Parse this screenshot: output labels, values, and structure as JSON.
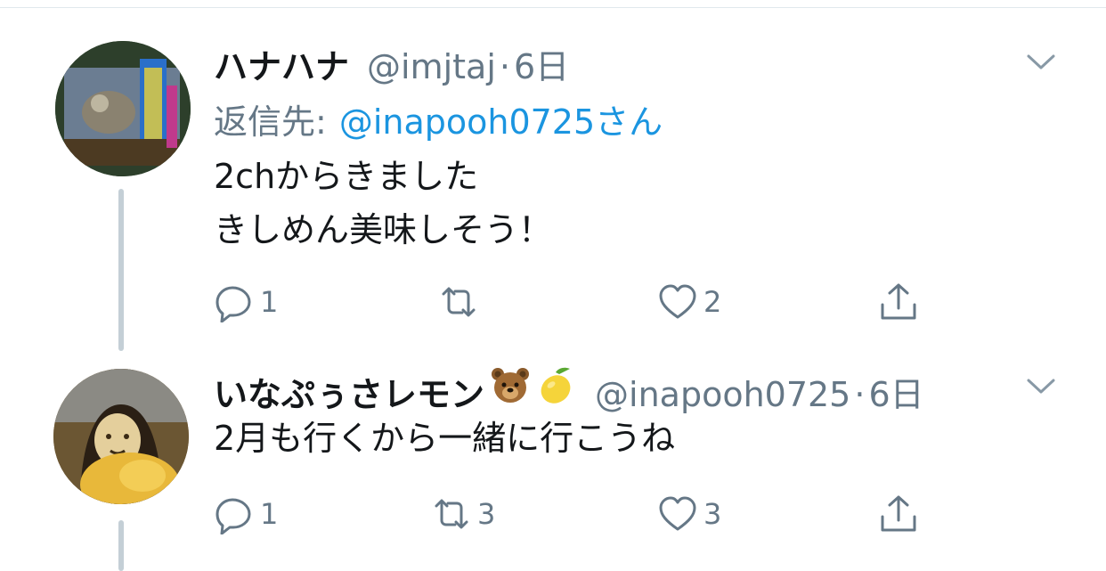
{
  "tweets": [
    {
      "display_name": "ハナハナ",
      "handle": "@imjtaj",
      "separator": "·",
      "time": "6日",
      "reply_label": "返信先:",
      "reply_mention": "@inapooh0725さん",
      "body_lines": [
        "2chからきました",
        "きしめん美味しそう！"
      ],
      "actions": {
        "reply_count": "1",
        "retweet_count": "",
        "like_count": "2"
      },
      "icons": {
        "more": "chevron-down-icon",
        "reply": "reply-icon",
        "retweet": "retweet-icon",
        "like": "heart-icon",
        "share": "share-icon"
      }
    },
    {
      "display_name": "いなぷぅさレモン",
      "emojis": [
        "bear-emoji",
        "lemon-emoji"
      ],
      "handle": "@inapooh0725",
      "separator": "·",
      "time": "6日",
      "body_lines": [
        "2月も行くから一緒に行こうね"
      ],
      "actions": {
        "reply_count": "1",
        "retweet_count": "3",
        "like_count": "3"
      },
      "icons": {
        "more": "chevron-down-icon",
        "reply": "reply-icon",
        "retweet": "retweet-icon",
        "like": "heart-icon",
        "share": "share-icon"
      }
    }
  ],
  "colors": {
    "text_primary": "#14171a",
    "text_secondary": "#657786",
    "link": "#1b95e0",
    "thread_line": "#c4cfd6",
    "divider": "#e1e8ed"
  }
}
